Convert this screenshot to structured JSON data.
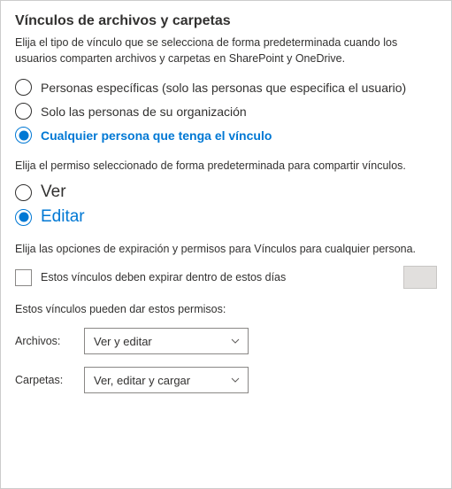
{
  "title": "Vínculos de archivos y carpetas",
  "intro": "Elija el tipo de vínculo que se selecciona de forma predeterminada cuando los usuarios comparten archivos y carpetas en SharePoint y OneDrive.",
  "link_type": {
    "options": [
      "Personas específicas (solo las personas que especifica el usuario)",
      "Solo las personas de su organización",
      "Cualquier persona que tenga el vínculo"
    ],
    "selected": 2
  },
  "permission_intro": "Elija el permiso seleccionado de forma predeterminada para compartir vínculos.",
  "permission": {
    "options": [
      "Ver",
      "Editar"
    ],
    "selected": 1
  },
  "expiration_intro": "Elija las opciones de expiración y permisos para Vínculos para cualquier persona.",
  "expiration_checkbox_label": "Estos vínculos deben expirar dentro de estos días",
  "permissions_label": "Estos vínculos pueden dar estos permisos:",
  "files": {
    "label": "Archivos:",
    "value": "Ver y editar"
  },
  "folders": {
    "label": "Carpetas:",
    "value": "Ver, editar y cargar"
  }
}
